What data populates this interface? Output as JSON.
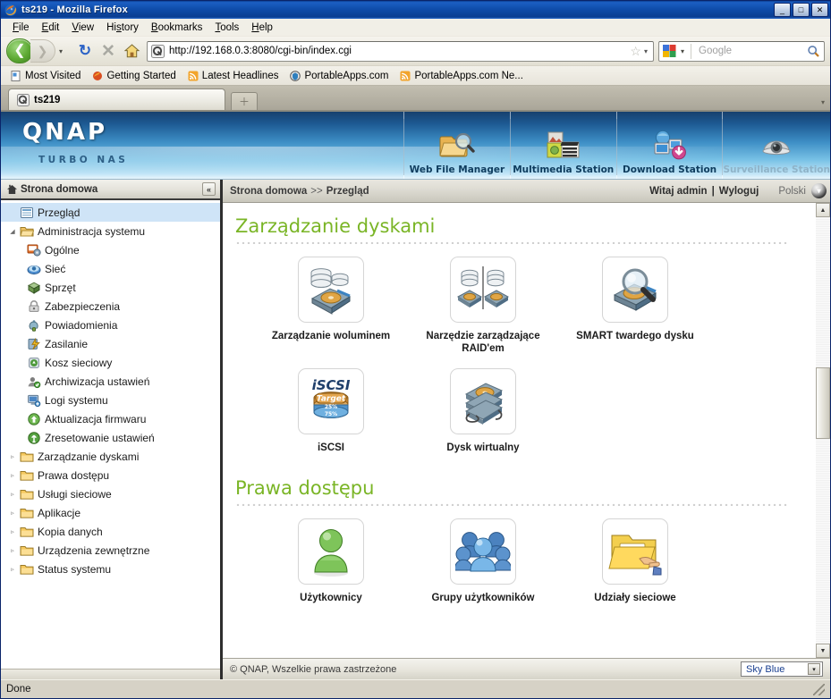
{
  "window": {
    "title": "ts219 - Mozilla Firefox",
    "minimize": "_",
    "maximize": "□",
    "close": "✕"
  },
  "menu": [
    {
      "label": "File"
    },
    {
      "label": "Edit"
    },
    {
      "label": "View"
    },
    {
      "label": "History"
    },
    {
      "label": "Bookmarks"
    },
    {
      "label": "Tools"
    },
    {
      "label": "Help"
    }
  ],
  "toolbar": {
    "back_glyph": "❮",
    "forward_glyph": "❯",
    "history_caret": "▾",
    "reload_glyph": "↻",
    "stop_glyph": "✕",
    "home_icon": "home-icon",
    "url": "http://192.168.0.3:8080/cgi-bin/index.cgi",
    "url_favicon": "qnap-favicon",
    "bookmark_star": "☆",
    "url_caret": "▾",
    "search_placeholder": "Google",
    "search_engine_icon": "google-icon",
    "search_caret": "▾",
    "search_glyph": "search-icon"
  },
  "bookmarks": [
    {
      "label": "Most Visited",
      "icon": "page-icon"
    },
    {
      "label": "Getting Started",
      "icon": "firefox-icon"
    },
    {
      "label": "Latest Headlines",
      "icon": "feed-icon"
    },
    {
      "label": "PortableApps.com",
      "icon": "portableapps-icon"
    },
    {
      "label": "PortableApps.com Ne...",
      "icon": "feed-icon"
    }
  ],
  "tabs": {
    "items": [
      {
        "label": "ts219",
        "icon": "qnap-favicon",
        "active": true
      }
    ],
    "new_tab_glyph": "＋",
    "list_caret": "▾"
  },
  "qnap": {
    "brand": "QNAP",
    "tagline": "TURBO NAS",
    "apps": [
      {
        "label": "Web File Manager",
        "icon": "folder-search-icon",
        "disabled": false
      },
      {
        "label": "Multimedia Station",
        "icon": "multimedia-icon",
        "disabled": false
      },
      {
        "label": "Download Station",
        "icon": "download-icon",
        "disabled": false
      },
      {
        "label": "Surveillance Station",
        "icon": "camera-icon",
        "disabled": true
      }
    ],
    "sidebar": {
      "header": "Strona domowa",
      "header_icon": "home-icon",
      "collapse_glyph": "«",
      "items": [
        {
          "label": "Przegląd",
          "level": 1,
          "icon": "overview-icon",
          "selected": true,
          "arrow": ""
        },
        {
          "label": "Administracja systemu",
          "level": 1,
          "icon": "folder-open-icon",
          "selected": false,
          "arrow": "◢"
        },
        {
          "label": "Ogólne",
          "level": 2,
          "icon": "general-icon",
          "selected": false,
          "arrow": ""
        },
        {
          "label": "Sieć",
          "level": 2,
          "icon": "network-icon",
          "selected": false,
          "arrow": ""
        },
        {
          "label": "Sprzęt",
          "level": 2,
          "icon": "hardware-icon",
          "selected": false,
          "arrow": ""
        },
        {
          "label": "Zabezpieczenia",
          "level": 2,
          "icon": "security-lock-icon",
          "selected": false,
          "arrow": ""
        },
        {
          "label": "Powiadomienia",
          "level": 2,
          "icon": "notification-icon",
          "selected": false,
          "arrow": ""
        },
        {
          "label": "Zasilanie",
          "level": 2,
          "icon": "power-icon",
          "selected": false,
          "arrow": ""
        },
        {
          "label": "Kosz sieciowy",
          "level": 2,
          "icon": "recycle-bin-icon",
          "selected": false,
          "arrow": ""
        },
        {
          "label": "Archiwizacja ustawień",
          "level": 2,
          "icon": "backup-settings-icon",
          "selected": false,
          "arrow": ""
        },
        {
          "label": "Logi systemu",
          "level": 2,
          "icon": "system-logs-icon",
          "selected": false,
          "arrow": ""
        },
        {
          "label": "Aktualizacja firmwaru",
          "level": 2,
          "icon": "firmware-update-icon",
          "selected": false,
          "arrow": ""
        },
        {
          "label": "Zresetowanie ustawień",
          "level": 2,
          "icon": "reset-settings-icon",
          "selected": false,
          "arrow": ""
        },
        {
          "label": "Zarządzanie dyskami",
          "level": 1,
          "icon": "folder-icon",
          "selected": false,
          "arrow": "▹"
        },
        {
          "label": "Prawa dostępu",
          "level": 1,
          "icon": "folder-icon",
          "selected": false,
          "arrow": "▹"
        },
        {
          "label": "Usługi sieciowe",
          "level": 1,
          "icon": "folder-icon",
          "selected": false,
          "arrow": "▹"
        },
        {
          "label": "Aplikacje",
          "level": 1,
          "icon": "folder-icon",
          "selected": false,
          "arrow": "▹"
        },
        {
          "label": "Kopia danych",
          "level": 1,
          "icon": "folder-icon",
          "selected": false,
          "arrow": "▹"
        },
        {
          "label": "Urządzenia zewnętrzne",
          "level": 1,
          "icon": "folder-icon",
          "selected": false,
          "arrow": "▹"
        },
        {
          "label": "Status systemu",
          "level": 1,
          "icon": "folder-icon",
          "selected": false,
          "arrow": "▹"
        }
      ]
    },
    "breadcrumb": {
      "root": "Strona domowa",
      "separator": ">>",
      "current": "Przegląd",
      "welcome": "Witaj admin",
      "welcome_sep": "|",
      "logout": "Wyloguj",
      "language": "Polski",
      "language_caret": "▾"
    },
    "sections": [
      {
        "title": "Zarządzanie dyskami",
        "rows": [
          [
            {
              "label": "Zarządzanie woluminem",
              "icon": "volume-management-icon"
            },
            {
              "label": "Narzędzie zarządzające RAID'em",
              "icon": "raid-management-icon"
            },
            {
              "label": "SMART twardego dysku",
              "icon": "smart-disk-icon"
            }
          ],
          [
            {
              "label": "iSCSI",
              "icon": "iscsi-icon"
            },
            {
              "label": "Dysk wirtualny",
              "icon": "virtual-disk-icon"
            }
          ]
        ]
      },
      {
        "title": "Prawa dostępu",
        "rows": [
          [
            {
              "label": "Użytkownicy",
              "icon": "user-icon"
            },
            {
              "label": "Grupy użytkowników",
              "icon": "user-groups-icon"
            },
            {
              "label": "Udziały sieciowe",
              "icon": "network-shares-icon"
            }
          ]
        ]
      }
    ],
    "footer": {
      "copyright": "© QNAP, Wszelkie prawa zastrzeżone",
      "theme_value": "Sky Blue",
      "theme_caret": "▾"
    },
    "scrollbar": {
      "up": "▲",
      "down": "▼"
    }
  },
  "status": {
    "text": "Done"
  },
  "colors": {
    "accent_green": "#7ab526",
    "banner_blue": "#3d8ec5",
    "selected_row": "#cfe4f7",
    "titlebar": "#0f4dab"
  }
}
